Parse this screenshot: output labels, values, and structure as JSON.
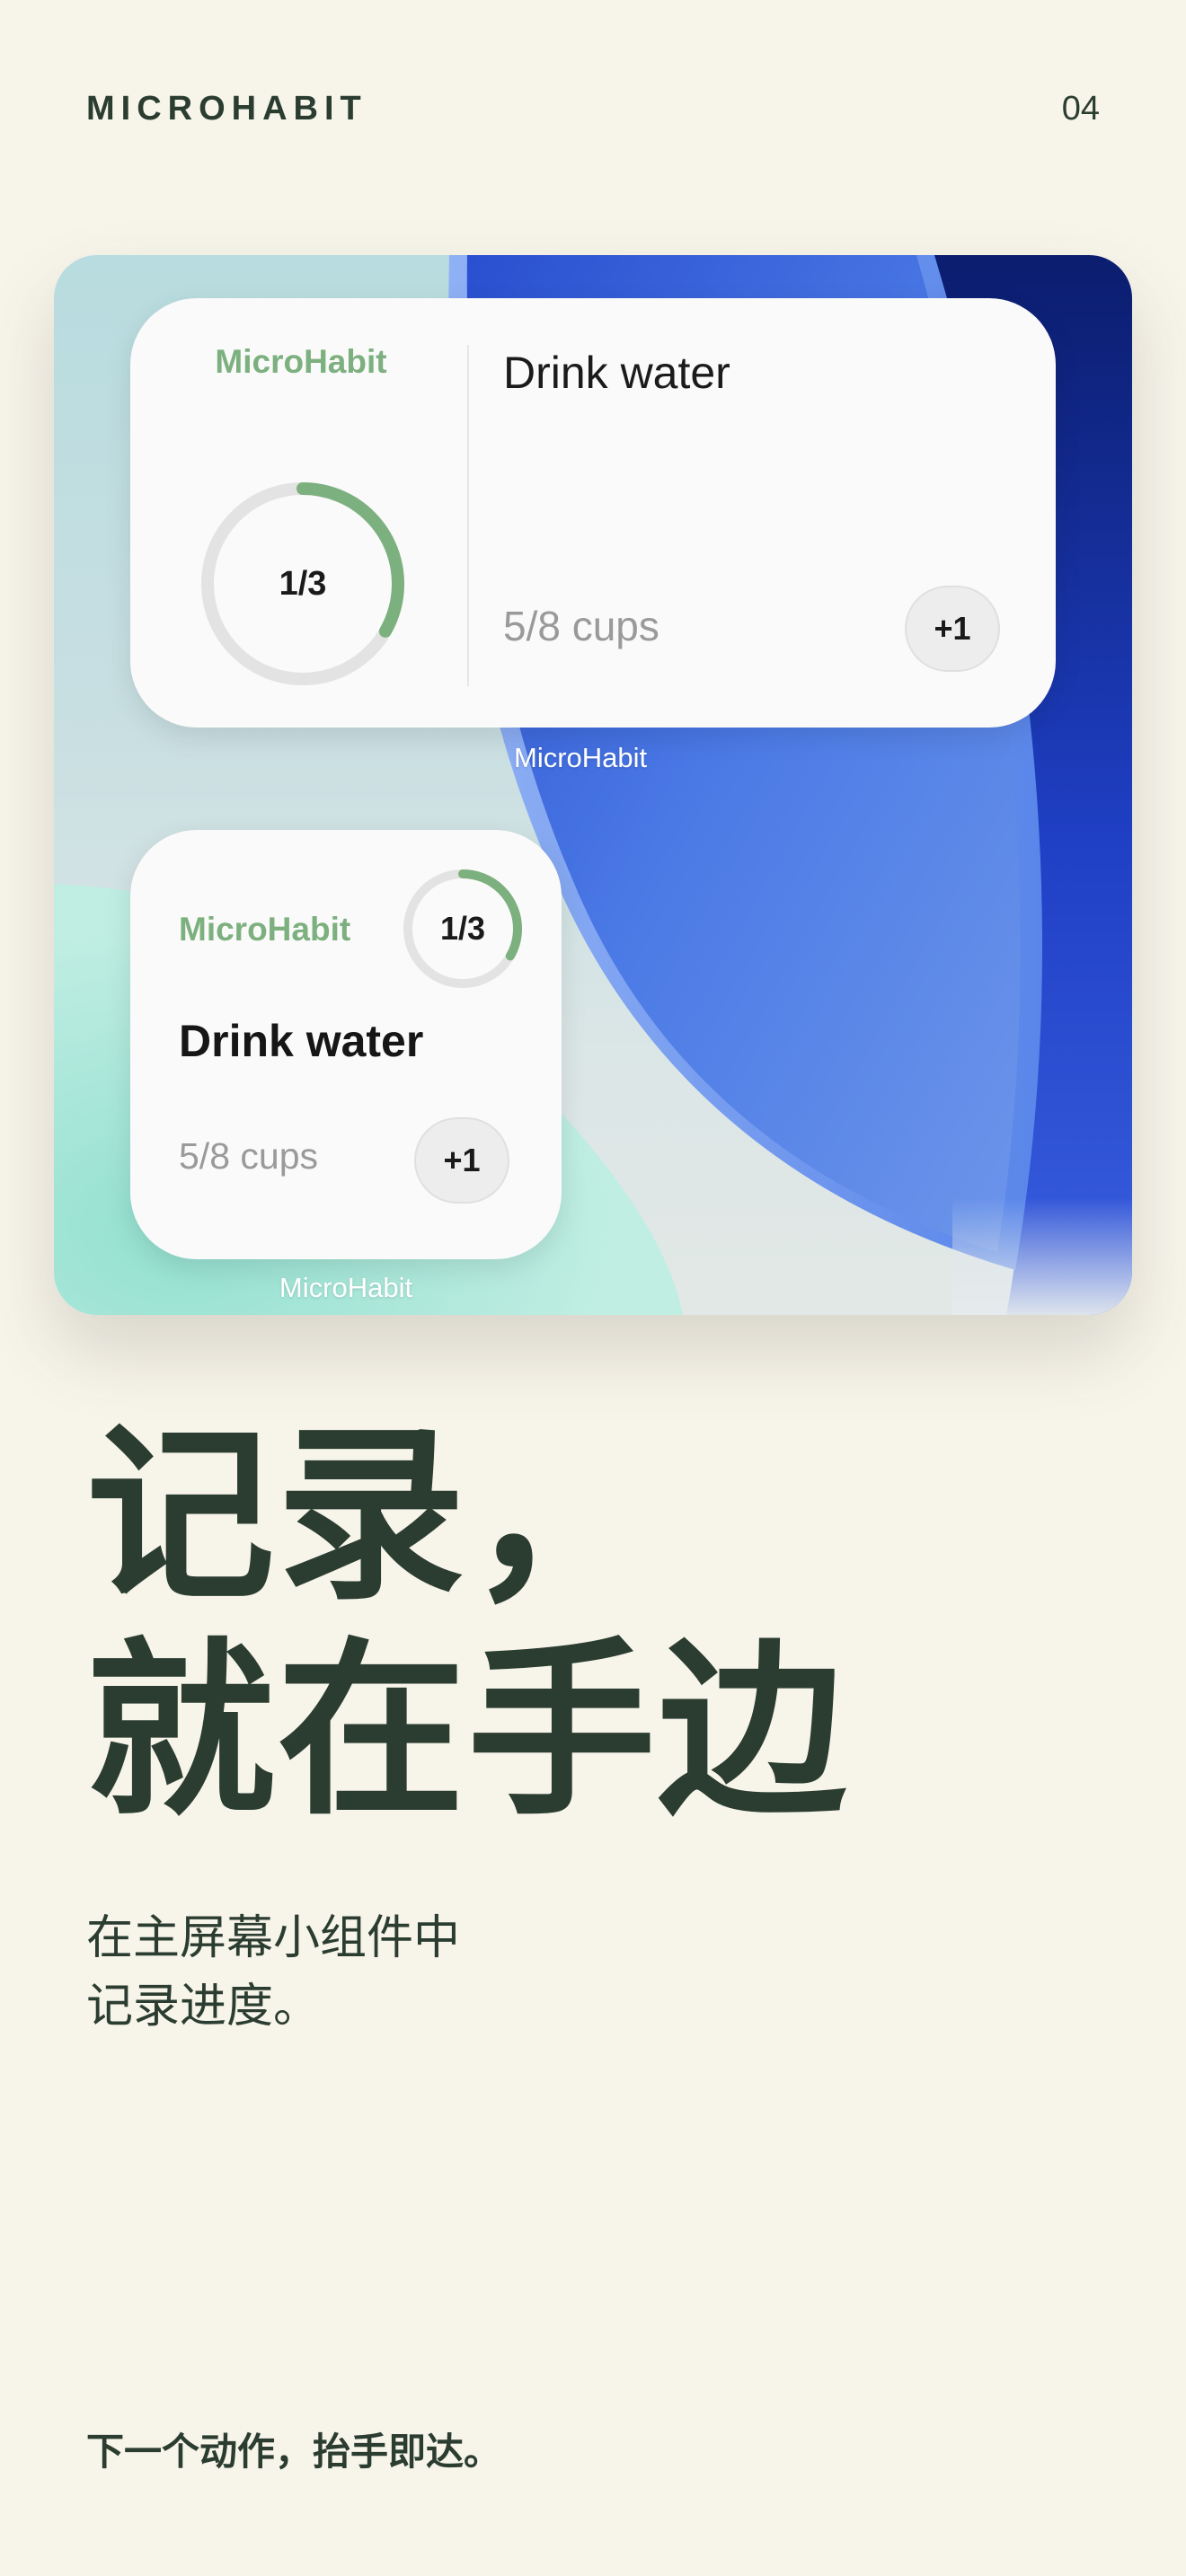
{
  "header": {
    "brand": "MICROHABIT",
    "page_number": "04"
  },
  "widget_medium": {
    "app_name": "MicroHabit",
    "progress_text": "1/3",
    "progress_fraction": 0.333,
    "habit_name": "Drink water",
    "count_text": "5/8 cups",
    "increment_label": "+1",
    "home_label": "MicroHabit"
  },
  "widget_small": {
    "app_name": "MicroHabit",
    "progress_text": "1/3",
    "progress_fraction": 0.333,
    "habit_name": "Drink water",
    "count_text": "5/8 cups",
    "increment_label": "+1",
    "home_label": "MicroHabit"
  },
  "headline": {
    "line1": "记录，",
    "line2": "就在手边"
  },
  "subtext": {
    "line1": "在主屏幕小组件中",
    "line2": "记录进度。"
  },
  "footer": {
    "text": "下一个动作，抬手即达。"
  },
  "colors": {
    "background": "#f7f4ea",
    "text_dark_green": "#2b3d30",
    "accent_green": "#7db07f",
    "wallpaper_blue": "#3f6fe0",
    "wallpaper_mint": "#a9e6d8"
  }
}
